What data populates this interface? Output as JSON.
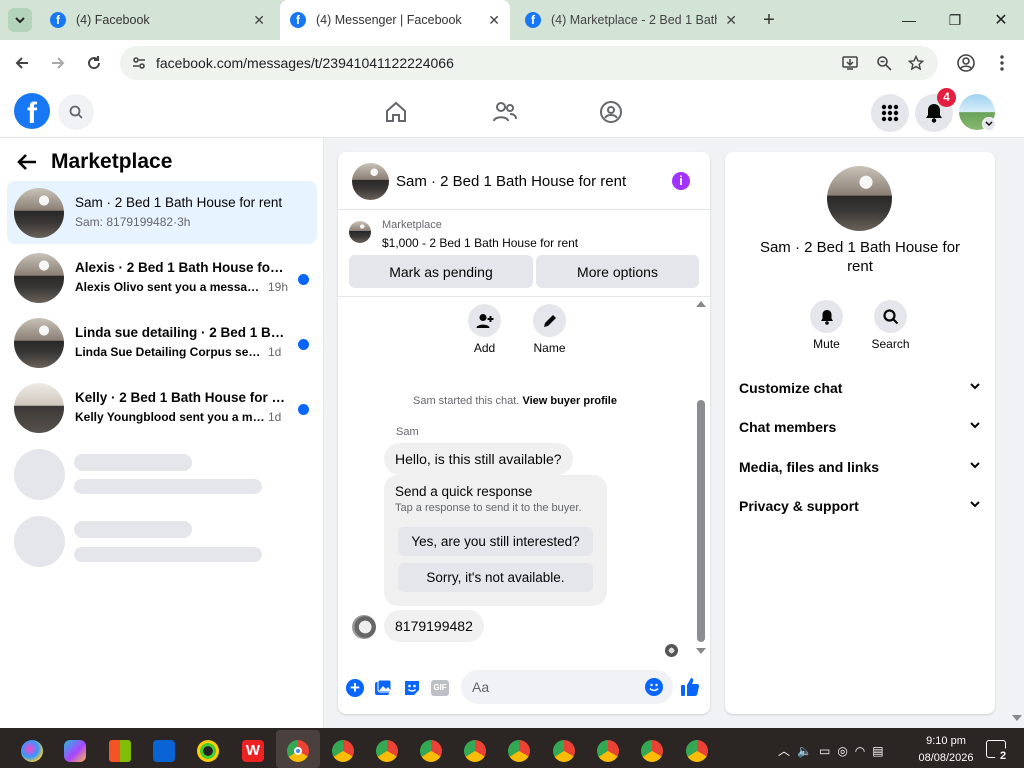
{
  "browser": {
    "tabs": [
      {
        "title": "(4) Facebook",
        "active": false
      },
      {
        "title": "(4) Messenger | Facebook",
        "active": true
      },
      {
        "title": "(4) Marketplace - 2 Bed 1 Bath H",
        "active": false
      }
    ],
    "url": "facebook.com/messages/t/23941041122224066"
  },
  "header": {
    "logo": "f",
    "notifications_count": "4"
  },
  "sidebar": {
    "title": "Marketplace",
    "conversations": [
      {
        "name": "Sam · 2 Bed 1 Bath House for rent",
        "preview": "Sam: 8179199482",
        "time": "·3h",
        "unread": false,
        "selected": true
      },
      {
        "name": "Alexis · 2 Bed 1 Bath House for r...",
        "preview": "Alexis Olivo sent you a message a...",
        "time": "19h",
        "unread": true,
        "selected": false
      },
      {
        "name": "Linda sue detailing · 2 Bed 1 Bath...",
        "preview": "Linda Sue Detailing Corpus sent yo...",
        "time": "1d",
        "unread": true,
        "selected": false
      },
      {
        "name": "Kelly · 2 Bed 1 Bath House for rent",
        "preview": "Kelly Youngblood sent you a mess...",
        "time": "1d",
        "unread": true,
        "selected": false
      }
    ]
  },
  "chat": {
    "title": "Sam · 2 Bed 1 Bath House for rent",
    "listing_source": "Marketplace",
    "listing_title": "$1,000 - 2 Bed 1 Bath House for rent",
    "mark_pending": "Mark as pending",
    "more_options": "More options",
    "add_label": "Add",
    "name_label": "Name",
    "started_text": "Sam started this chat.",
    "view_profile": "View buyer profile",
    "sender": "Sam",
    "msg1": "Hello, is this still available?",
    "quick_title": "Send a quick response",
    "quick_sub": "Tap a response to send it to the buyer.",
    "quick1": "Yes, are you still interested?",
    "quick2": "Sorry, it's not available.",
    "msg2": "8179199482",
    "composer_placeholder": "Aa",
    "gif_label": "GIF"
  },
  "details": {
    "name": "Sam · 2 Bed 1 Bath House for rent",
    "mute": "Mute",
    "search": "Search",
    "sections": [
      "Customize chat",
      "Chat members",
      "Media, files and links",
      "Privacy & support"
    ]
  },
  "taskbar": {
    "time": "9:10 pm",
    "date": "08/08/2026",
    "notif": "2"
  },
  "colors": {
    "brand": "#1877f2",
    "unread_dot": "#0866ff",
    "info_purple": "#a033ff",
    "badge": "#e41e3f"
  }
}
